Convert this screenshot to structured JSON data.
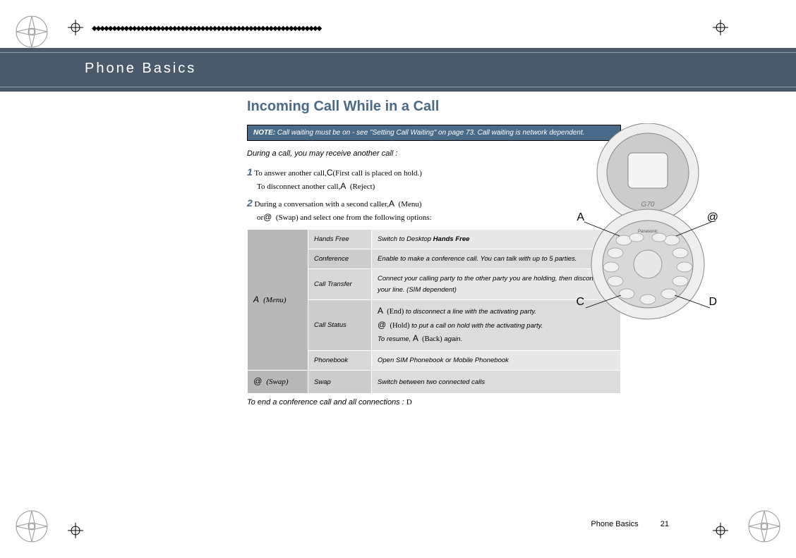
{
  "header": {
    "title": "Phone Basics"
  },
  "section": {
    "title": "Incoming Call While in a Call",
    "note_label": "NOTE:",
    "note_text": "Call waiting must be on - see \"Setting Call Waiting\" on page 73. Call waiting is network dependent.",
    "intro": "During a call, you may receive another call :",
    "step1_num": "1",
    "step1_a": "To answer another call,",
    "step1_a_key": "C",
    "step1_a_tail": "(First call is placed on hold.)",
    "step1_b": "To disconnect another call,",
    "step1_b_key": "A",
    "step1_b_tail": "(Reject)",
    "step2_num": "2",
    "step2_a": "During a conversation with a second caller,",
    "step2_a_key": "A",
    "step2_a_tail": "(Menu)",
    "step2_b_pre": "or",
    "step2_b_key": "@",
    "step2_b_tail": "(Swap) and select one from the following options:",
    "end_text": "To end a conference call and all connections :",
    "end_key": "D"
  },
  "table": {
    "menu_key": "A",
    "menu_label": "(Menu)",
    "swap_key": "@",
    "swap_label": "(Swap)",
    "rows": [
      {
        "name": "Hands Free",
        "desc_pre": "Switch to Desktop ",
        "desc_bold": "Hands Free"
      },
      {
        "name": "Conference",
        "desc": "Enable to make a conference call. You can talk with up to 5 parties."
      },
      {
        "name": "Call Transfer",
        "desc": "Connect your calling party to the other party you are holding, then disconnect your line. (SIM dependent)"
      },
      {
        "name": "Call Status",
        "cs_k1": "A",
        "cs_p1": "(End)",
        "cs_t1": "to disconnect a line with the activating party.",
        "cs_k2": "@",
        "cs_p2": "(Hold)",
        "cs_t2": "to put a call on hold with the activating party.",
        "cs_t3_pre": "To resume, ",
        "cs_k3": "A",
        "cs_p3": "(Back)",
        "cs_t3_post": " again."
      },
      {
        "name": "Phonebook",
        "desc": "Open SIM Phonebook or Mobile Phonebook"
      },
      {
        "name": "Swap",
        "desc": "Switch between two connected calls"
      }
    ]
  },
  "phone_labels": {
    "A": "A",
    "at": "@",
    "C": "C",
    "D": "D"
  },
  "footer": {
    "section": "Phone Basics",
    "page": "21"
  }
}
